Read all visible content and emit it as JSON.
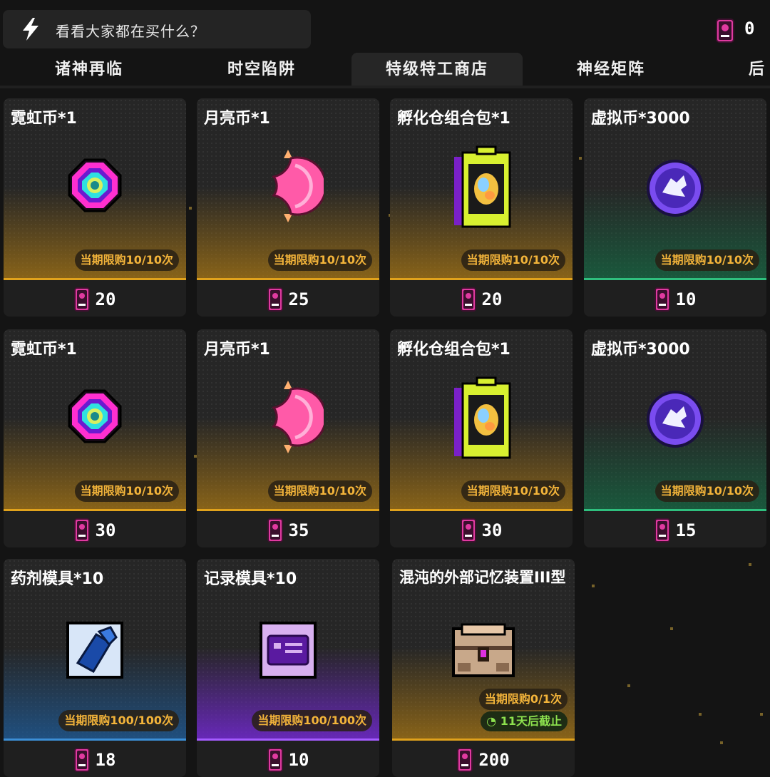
{
  "search": {
    "placeholder": "看看大家都在买什么？"
  },
  "wallet": {
    "amount": "0"
  },
  "tabs": [
    {
      "label": "诸神再临",
      "active": false
    },
    {
      "label": "时空陷阱",
      "active": false
    },
    {
      "label": "特级特工商店",
      "active": true
    },
    {
      "label": "神经矩阵",
      "active": false
    },
    {
      "label": "后",
      "active": false
    }
  ],
  "items": [
    {
      "title": "霓虹币*1",
      "limit": "当期限购10/10次",
      "price": "20",
      "theme": "gold",
      "icon": "neon-coin-icon"
    },
    {
      "title": "月亮币*1",
      "limit": "当期限购10/10次",
      "price": "25",
      "theme": "gold",
      "icon": "moon-coin-icon"
    },
    {
      "title": "孵化仓组合包*1",
      "limit": "当期限购10/10次",
      "price": "20",
      "theme": "gold",
      "icon": "incubator-pack-icon"
    },
    {
      "title": "虚拟币*3000",
      "limit": "当期限购10/10次",
      "price": "10",
      "theme": "green",
      "icon": "virtual-coin-icon"
    },
    {
      "title": "霓虹币*1",
      "limit": "当期限购10/10次",
      "price": "30",
      "theme": "gold",
      "icon": "neon-coin-icon"
    },
    {
      "title": "月亮币*1",
      "limit": "当期限购10/10次",
      "price": "35",
      "theme": "gold",
      "icon": "moon-coin-icon"
    },
    {
      "title": "孵化仓组合包*1",
      "limit": "当期限购10/10次",
      "price": "30",
      "theme": "gold",
      "icon": "incubator-pack-icon"
    },
    {
      "title": "虚拟币*3000",
      "limit": "当期限购10/10次",
      "price": "15",
      "theme": "green",
      "icon": "virtual-coin-icon"
    },
    {
      "title": "药剂模具*10",
      "limit": "当期限购100/100次",
      "price": "18",
      "theme": "blue",
      "icon": "potion-mold-icon"
    },
    {
      "title": "记录模具*10",
      "limit": "当期限购100/100次",
      "price": "10",
      "theme": "purple",
      "icon": "record-mold-icon"
    },
    {
      "title": "混沌的外部记忆装置III型",
      "limit": "当期限购0/1次",
      "deadline": "11天后截止",
      "price": "200",
      "theme": "gold",
      "icon": "chaos-memory-device-icon"
    }
  ],
  "colors": {
    "accent_gold": "#f3b43a",
    "accent_green": "#2fbf7e",
    "currency_pink": "#e03aa0"
  }
}
